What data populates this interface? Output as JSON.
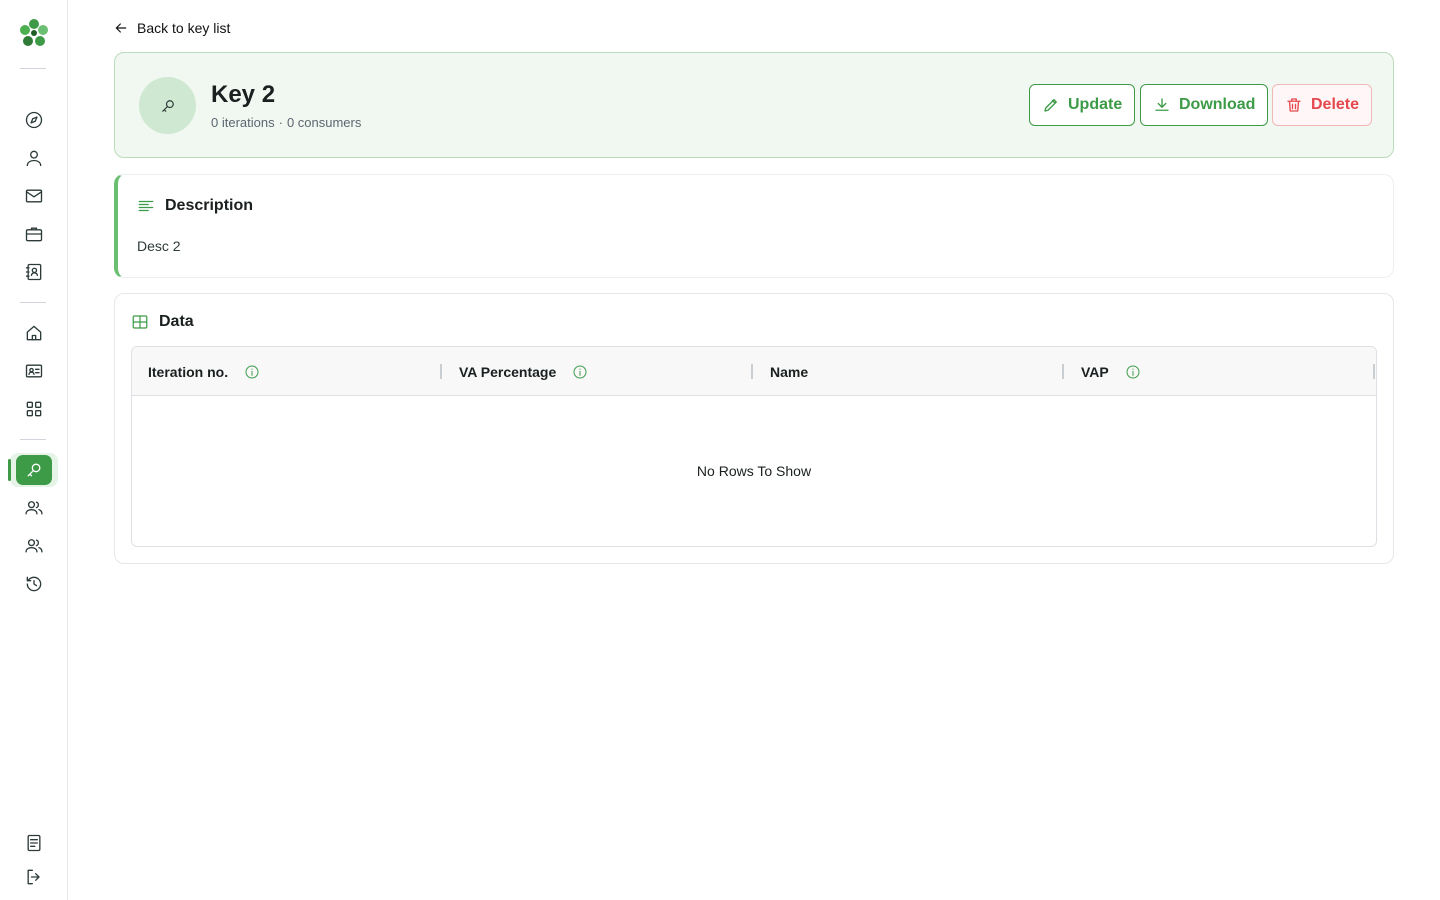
{
  "nav": {
    "back_label": "Back to key list"
  },
  "key": {
    "title": "Key 2",
    "iterations": "0 iterations",
    "separator": "·",
    "consumers": "0 consumers"
  },
  "actions": {
    "update_label": "Update",
    "download_label": "Download",
    "delete_label": "Delete"
  },
  "description": {
    "heading": "Description",
    "text": "Desc 2"
  },
  "data_section": {
    "heading": "Data",
    "columns": [
      "Iteration no.",
      "VA Percentage",
      "Name",
      "VAP"
    ],
    "empty_text": "No Rows To Show"
  },
  "sidebar": {
    "icons": [
      "compass-icon",
      "user-icon",
      "mail-icon",
      "briefcase-icon",
      "contacts-icon",
      "home-icon",
      "id-card-icon",
      "apps-grid-icon",
      "key-icon",
      "users-icon",
      "team-icon",
      "history-icon",
      "document-icon",
      "logout-icon"
    ],
    "active": "key-icon"
  },
  "colors": {
    "accent": "#3d9b47",
    "danger": "#e5484d",
    "header_bg": "#f1f8f1"
  }
}
